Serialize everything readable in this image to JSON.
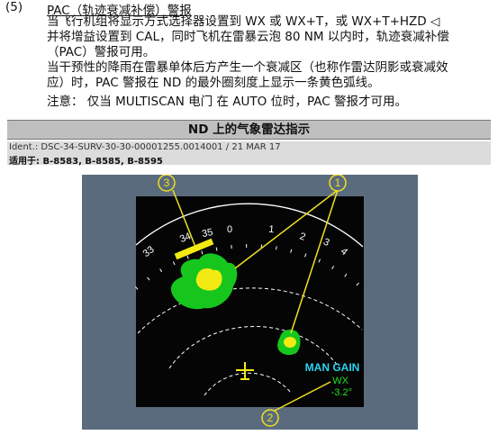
{
  "section": {
    "number": "(5)",
    "heading": "PAC（轨迹衰减补偿）警报",
    "paragraph1": [
      "当飞行机组将显示方式选择器设置到 WX 或 WX+T，或 WX+T+HZD ◁",
      "并将增益设置到 CAL，同时飞机在雷暴云泡 80 NM 以内时，轨迹衰减补偿",
      "（PAC）警报可用。"
    ],
    "paragraph2": [
      "当干预性的降雨在雷暴单体后方产生一个衰减区（也称作雷达阴影或衰减效",
      "应）时，PAC 警报在 ND 的最外圈刻度上显示一条黄色弧线。"
    ],
    "note": "注意：  仅当 MULTISCAN 电门 在 AUTO 位时，PAC 警报才可用。"
  },
  "figure": {
    "title": "ND 上的气象雷达指示",
    "ident": "Ident.: DSC-34-SURV-30-30-00001255.0014001 / 21 MAR 17",
    "applicable": "适用于: B-8583, B-8585, B-8595",
    "compass_ticks": [
      "33",
      "34",
      "35",
      "0",
      "1",
      "2",
      "3",
      "4"
    ],
    "mode_label": "MAN GAIN",
    "wx_label": "WX",
    "tilt_label": "-3.2°",
    "callouts": [
      "1",
      "2",
      "3"
    ],
    "colors": {
      "screen": "#050505",
      "bezel": "#5a6b7d",
      "heavy": "#f4ea13",
      "light": "#16c61d",
      "pac_arc": "#f4ea13",
      "cyan": "#2ad4f0",
      "green_text": "#22e022",
      "callout": "#f0e020"
    }
  }
}
